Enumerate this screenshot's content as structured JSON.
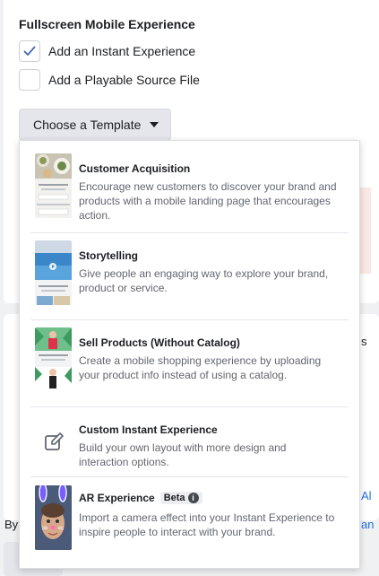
{
  "section": {
    "title": "Fullscreen Mobile Experience",
    "checkboxes": [
      {
        "label": "Add an Instant Experience",
        "checked": true
      },
      {
        "label": "Add a Playable Source File",
        "checked": false
      }
    ]
  },
  "template_button": {
    "label": "Choose a Template"
  },
  "background_fragments": {
    "right_s": "s",
    "right_al": "Al",
    "left_by": "By",
    "right_an": "an"
  },
  "colors": {
    "accent": "#4267b2",
    "link": "#216fdb",
    "text_primary": "#1c1e21",
    "text_secondary": "#606770"
  },
  "templates": [
    {
      "title": "Customer Acquisition",
      "description": "Encourage new customers to discover your brand and products with a mobile landing page that encourages action.",
      "thumbnail": "food-landing-thumbnail"
    },
    {
      "title": "Storytelling",
      "description": "Give people an engaging way to explore your brand, product or service.",
      "thumbnail": "pool-video-thumbnail"
    },
    {
      "title": "Sell Products (Without Catalog)",
      "description": "Create a mobile shopping experience by uploading your product info instead of using a catalog.",
      "thumbnail": "fashion-shop-thumbnail"
    },
    {
      "title": "Custom Instant Experience",
      "description": "Build your own layout with more design and interaction options.",
      "thumbnail": "edit-icon"
    },
    {
      "title": "AR Experience",
      "badge": "Beta",
      "description": "Import a camera effect into your Instant Experience to inspire people to interact with your brand.",
      "thumbnail": "ar-face-filter-thumbnail"
    }
  ]
}
